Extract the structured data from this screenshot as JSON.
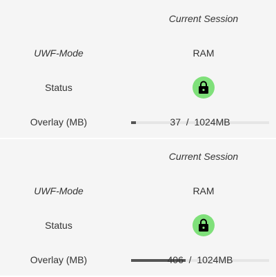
{
  "panels": [
    {
      "header": "Current Session",
      "mode_label": "UWF-Mode",
      "mode_value": "RAM",
      "status_label": "Status",
      "status_icon": "lock-icon",
      "overlay_label": "Overlay (MB)",
      "overlay_used": "37",
      "overlay_total": "1024MB",
      "overlay_fraction": 0.036
    },
    {
      "header": "Current Session",
      "mode_label": "UWF-Mode",
      "mode_value": "RAM",
      "status_label": "Status",
      "status_icon": "lock-icon",
      "overlay_label": "Overlay (MB)",
      "overlay_used": "406",
      "overlay_total": "1024MB",
      "overlay_fraction": 0.396
    }
  ],
  "colors": {
    "status_badge": "#7fe07a",
    "bar_fill": "#555555",
    "bar_track": "#e6e6e6"
  }
}
